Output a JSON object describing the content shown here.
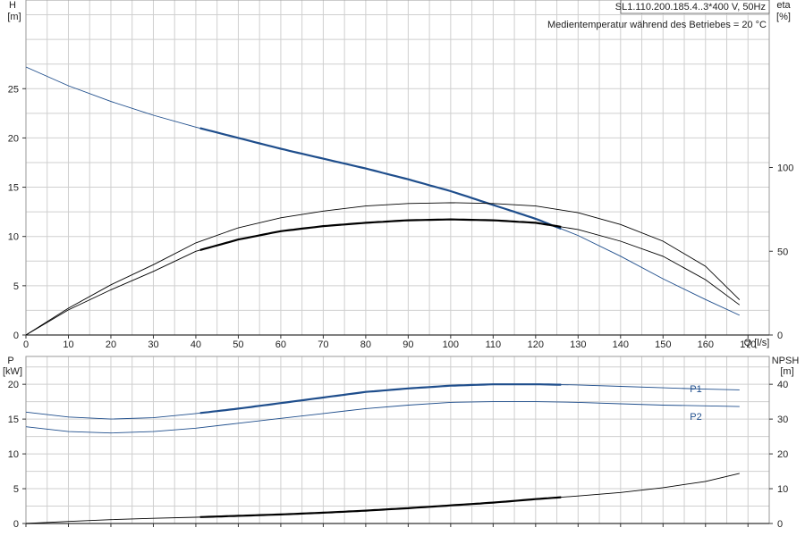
{
  "chart_data": [
    {
      "type": "line",
      "id": "top",
      "x_axis": {
        "label": "Q [l/s]",
        "min": 0,
        "max": 175,
        "ticks": [
          0,
          10,
          20,
          30,
          40,
          50,
          60,
          70,
          80,
          90,
          100,
          110,
          120,
          130,
          140,
          150,
          160,
          170
        ]
      },
      "y_left": {
        "label": "H",
        "unit": "[m]",
        "min": 0,
        "max": 34,
        "ticks": [
          0,
          5,
          10,
          15,
          20,
          25
        ]
      },
      "y_right": {
        "label": "eta",
        "unit": "[%]",
        "min": 0,
        "max": 200,
        "ticks": [
          0,
          50,
          100
        ]
      },
      "annotations": [
        {
          "text": "SL1.110.200.185.4..3*400 V, 50Hz",
          "boxed": true,
          "position": "top-right"
        },
        {
          "text": "Medientemperatur während des Betriebes = 20 °C",
          "boxed": false,
          "position": "top-right"
        }
      ],
      "series": [
        {
          "axis": "left",
          "color": "#1f4e8c",
          "highlight": [
            41,
            126
          ],
          "x": [
            0,
            10,
            20,
            30,
            40,
            50,
            60,
            70,
            80,
            90,
            100,
            110,
            120,
            130,
            140,
            150,
            160,
            168
          ],
          "y": [
            27.2,
            25.3,
            23.7,
            22.3,
            21.1,
            20.0,
            18.9,
            17.9,
            16.9,
            15.8,
            14.6,
            13.2,
            11.8,
            10.1,
            8.0,
            5.7,
            3.6,
            2.0
          ]
        },
        {
          "axis": "right",
          "color": "#000000",
          "highlight": null,
          "x": [
            0,
            10,
            20,
            30,
            40,
            50,
            60,
            70,
            80,
            90,
            100,
            110,
            120,
            130,
            140,
            150,
            160,
            168
          ],
          "y": [
            0,
            16,
            30,
            42,
            55,
            64,
            70,
            74,
            77,
            78.5,
            79,
            78.5,
            77,
            73,
            66,
            56,
            41,
            21
          ]
        },
        {
          "axis": "right",
          "color": "#000000",
          "highlight": [
            41,
            126
          ],
          "x": [
            0,
            10,
            20,
            30,
            40,
            50,
            60,
            70,
            80,
            90,
            100,
            110,
            120,
            130,
            140,
            150,
            160,
            168
          ],
          "y": [
            0,
            15,
            27,
            38,
            50,
            57,
            62,
            65,
            67,
            68.5,
            69,
            68.5,
            67,
            63,
            56,
            47,
            33,
            18
          ]
        }
      ]
    },
    {
      "type": "line",
      "id": "bottom",
      "x_axis": {
        "label": "",
        "min": 0,
        "max": 175,
        "ticks": []
      },
      "y_left": {
        "label": "P",
        "unit": "[kW]",
        "min": 0,
        "max": 24,
        "ticks": [
          0,
          5,
          10,
          15,
          20
        ]
      },
      "y_right": {
        "label": "NPSH",
        "unit": "[m]",
        "min": 0,
        "max": 48,
        "ticks": [
          0,
          10,
          20,
          30,
          40
        ]
      },
      "series": [
        {
          "name": "P1",
          "axis": "left",
          "color": "#1f4e8c",
          "highlight": [
            41,
            126
          ],
          "x": [
            0,
            10,
            20,
            30,
            40,
            50,
            60,
            70,
            80,
            90,
            100,
            110,
            120,
            130,
            140,
            150,
            160,
            168
          ],
          "y": [
            16.0,
            15.3,
            15.0,
            15.2,
            15.8,
            16.5,
            17.3,
            18.1,
            18.9,
            19.4,
            19.8,
            20.0,
            20.0,
            19.9,
            19.7,
            19.5,
            19.3,
            19.2
          ]
        },
        {
          "name": "P2",
          "axis": "left",
          "color": "#1f4e8c",
          "highlight": null,
          "x": [
            0,
            10,
            20,
            30,
            40,
            50,
            60,
            70,
            80,
            90,
            100,
            110,
            120,
            130,
            140,
            150,
            160,
            168
          ],
          "y": [
            13.9,
            13.2,
            13.0,
            13.2,
            13.7,
            14.4,
            15.1,
            15.8,
            16.5,
            17.0,
            17.4,
            17.5,
            17.5,
            17.4,
            17.2,
            17.0,
            16.9,
            16.8
          ]
        },
        {
          "name": "NPSH",
          "axis": "right",
          "color": "#000000",
          "highlight": [
            41,
            126
          ],
          "x": [
            0,
            10,
            20,
            30,
            40,
            50,
            60,
            70,
            80,
            90,
            100,
            110,
            120,
            130,
            140,
            150,
            160,
            168
          ],
          "y": [
            0,
            0.6,
            1.1,
            1.5,
            1.8,
            2.2,
            2.6,
            3.1,
            3.7,
            4.4,
            5.2,
            6.0,
            7.0,
            7.9,
            8.9,
            10.3,
            12.1,
            14.4
          ]
        }
      ]
    }
  ]
}
